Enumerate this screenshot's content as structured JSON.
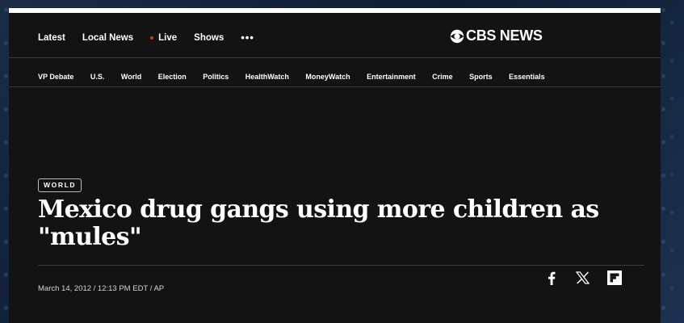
{
  "top_nav": {
    "links": [
      "Latest",
      "Local News",
      "Live",
      "Shows"
    ],
    "more_label": "•••",
    "logo_text": "CBS NEWS",
    "live_dot_color": "#e0321c"
  },
  "section_nav": [
    "VP Debate",
    "U.S.",
    "World",
    "Election",
    "Politics",
    "HealthWatch",
    "MoneyWatch",
    "Entertainment",
    "Crime",
    "Sports",
    "Essentials"
  ],
  "article": {
    "category": "WORLD",
    "headline": "Mexico drug gangs using more children as \"mules\"",
    "byline": "March 14, 2012 / 12:13 PM EDT / AP"
  },
  "share_icons": [
    "facebook-icon",
    "x-icon",
    "flipboard-icon"
  ]
}
